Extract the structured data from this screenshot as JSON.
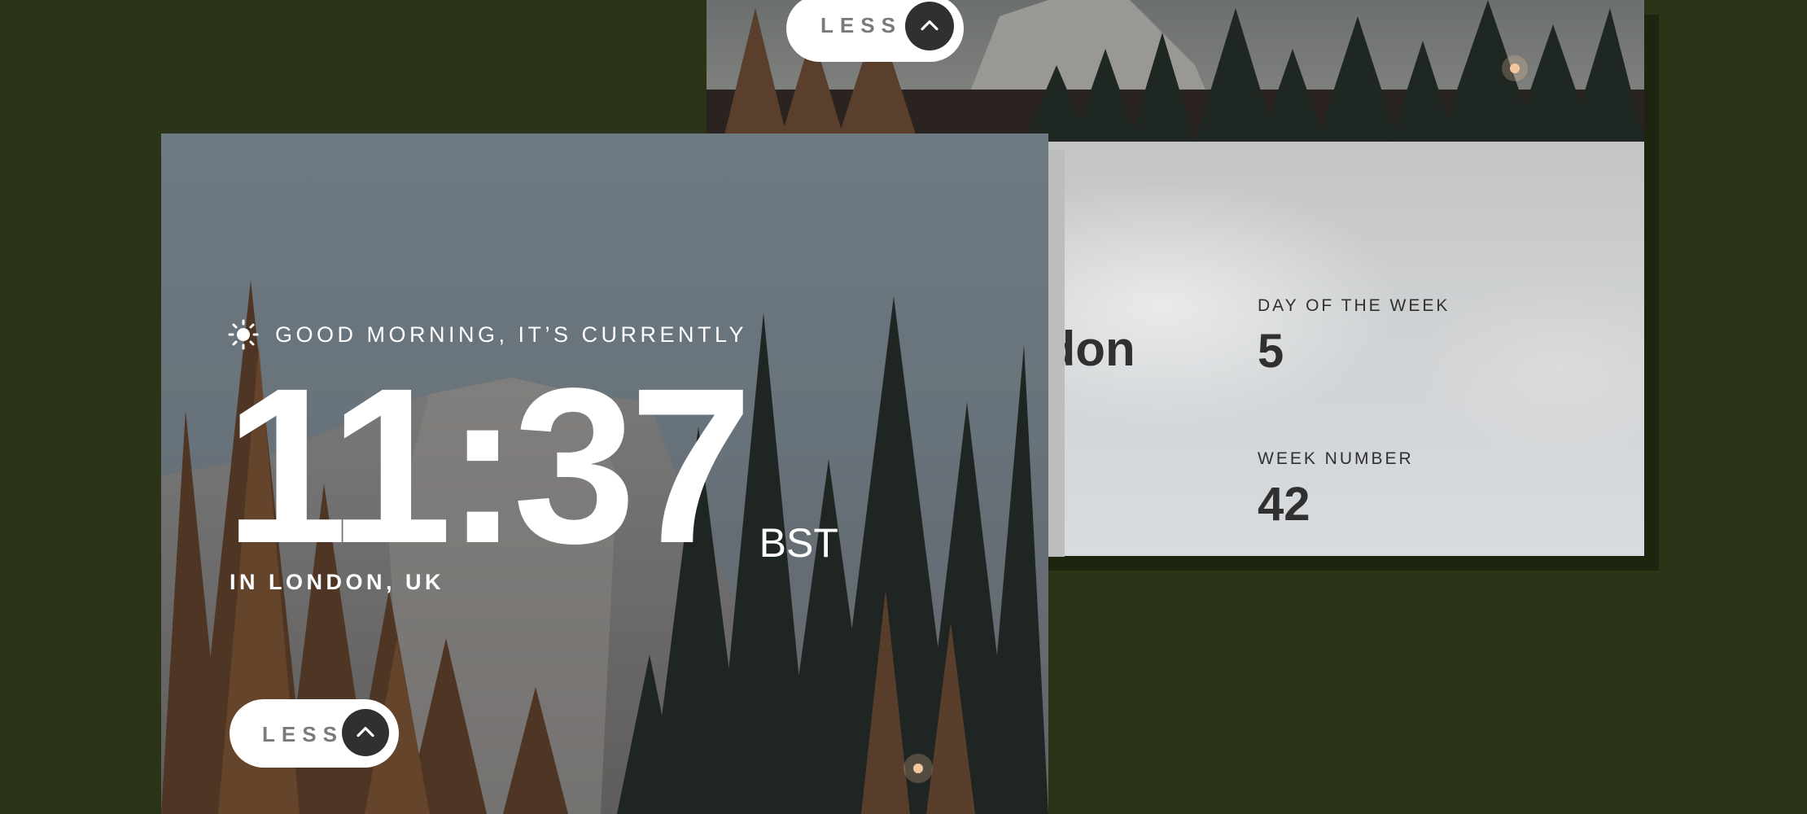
{
  "back_panel": {
    "less_button": {
      "label": "LESS",
      "icon": "chevron-up-icon"
    },
    "city_fragment": "ndon",
    "day_of_week": {
      "label": "DAY OF THE WEEK",
      "value": "5"
    },
    "week_number": {
      "label": "WEEK NUMBER",
      "value": "42"
    }
  },
  "front_panel": {
    "greeting": {
      "icon": "sun-icon",
      "text": "GOOD MORNING, IT’S CURRENTLY"
    },
    "time": "11:37",
    "timezone": "BST",
    "location": "IN LONDON, UK",
    "less_button": {
      "label": "LESS",
      "icon": "chevron-up-icon"
    }
  },
  "colors": {
    "page_background": "#2b3416",
    "text_dark": "#303030",
    "text_light": "#ffffff",
    "button_label": "#7a7a7a"
  }
}
